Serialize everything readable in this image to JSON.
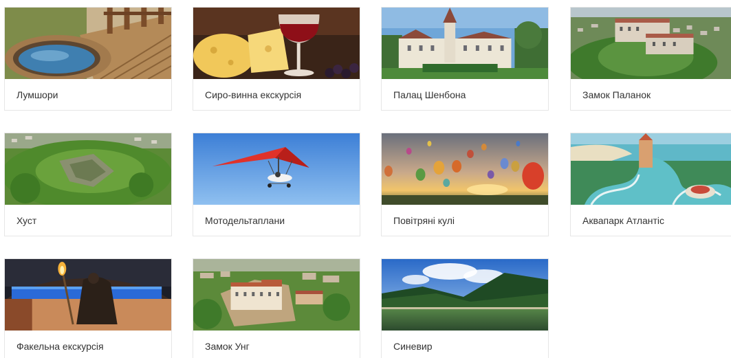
{
  "tours": [
    {
      "label": "Лумшори"
    },
    {
      "label": "Сиро-винна екскурсія"
    },
    {
      "label": "Палац Шенбона"
    },
    {
      "label": "Замок Паланок"
    },
    {
      "label": "Хуст"
    },
    {
      "label": "Мотодельтаплани"
    },
    {
      "label": "Повітряні кулі"
    },
    {
      "label": "Аквапарк Атлантіс"
    },
    {
      "label": "Факельна екскурсія"
    },
    {
      "label": "Замок Унг"
    },
    {
      "label": "Синевир"
    }
  ]
}
